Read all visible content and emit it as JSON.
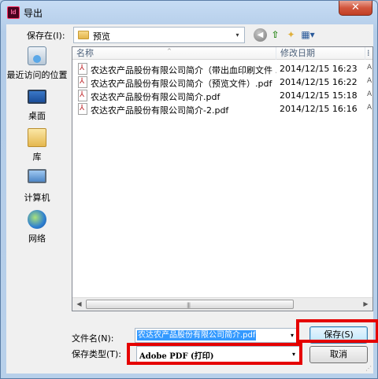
{
  "window": {
    "title": "导出",
    "app_icon_text": "Id",
    "close_label": "✕"
  },
  "lookin": {
    "label": "保存在(I):",
    "value": "预览",
    "arrow": "▾"
  },
  "toolbar": {
    "back": "◀",
    "up": "⇧",
    "new_folder": "✦",
    "views": "▦▾"
  },
  "places": [
    {
      "label": "最近访问的位置",
      "icon": "recent-places-icon"
    },
    {
      "label": "桌面",
      "icon": "desktop-icon"
    },
    {
      "label": "库",
      "icon": "library-icon"
    },
    {
      "label": "计算机",
      "icon": "computer-icon"
    },
    {
      "label": "网络",
      "icon": "network-icon"
    }
  ],
  "columns": {
    "name": "名称",
    "date": "修改日期",
    "extra": "⁞",
    "sort_indicator": "^"
  },
  "files": [
    {
      "name": "农达农产品股份有限公司简介（带出血印刷文件 ...",
      "date": "2014/12/15 16:23",
      "extra": "A"
    },
    {
      "name": "农达农产品股份有限公司简介（预览文件）.pdf",
      "date": "2014/12/15 16:22",
      "extra": "A"
    },
    {
      "name": "农达农产品股份有限公司简介.pdf",
      "date": "2014/12/15 15:18",
      "extra": "A"
    },
    {
      "name": "农达农产品股份有限公司简介-2.pdf",
      "date": "2014/12/15 16:16",
      "extra": "A"
    }
  ],
  "scrollbar": {
    "left": "◀",
    "right": "▶",
    "grip": "|||"
  },
  "filename": {
    "label": "文件名(N):",
    "value": "农达农产品股份有限公司简介.pdf",
    "arrow": "▾"
  },
  "filetype": {
    "label": "保存类型(T):",
    "value": "Adobe PDF (打印)",
    "arrow": "▾"
  },
  "buttons": {
    "save": "保存(S)",
    "cancel": "取消"
  },
  "colors": {
    "highlight": "#e50000",
    "selection": "#3399ff"
  }
}
